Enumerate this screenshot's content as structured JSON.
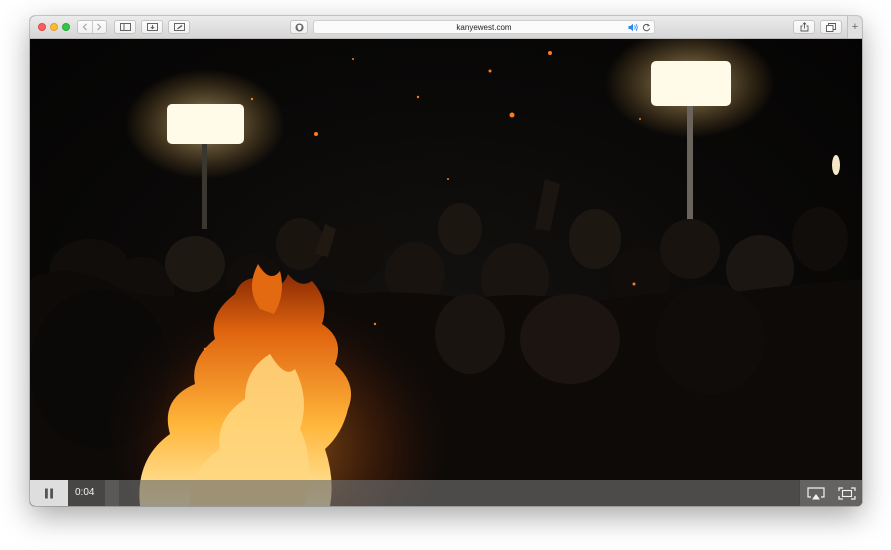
{
  "browser": {
    "url": "kanyewest.com",
    "audio_icon": "speaker-icon",
    "reload_icon": "reload-icon",
    "new_tab_label": "+",
    "toolbar_icons": [
      "back-icon",
      "forward-icon",
      "sidebar-icon",
      "downloads-icon",
      "reader-icon",
      "share-icon",
      "tabs-overview-icon"
    ]
  },
  "video": {
    "time": "0:04",
    "progress": 0.02,
    "controls": [
      "pause-icon",
      "airplay-icon",
      "fullscreen-icon"
    ]
  },
  "colors": {
    "accent": "#2f87e6",
    "traffic_red": "#fc5f57",
    "traffic_yellow": "#fdbc2e",
    "traffic_green": "#33c748"
  }
}
